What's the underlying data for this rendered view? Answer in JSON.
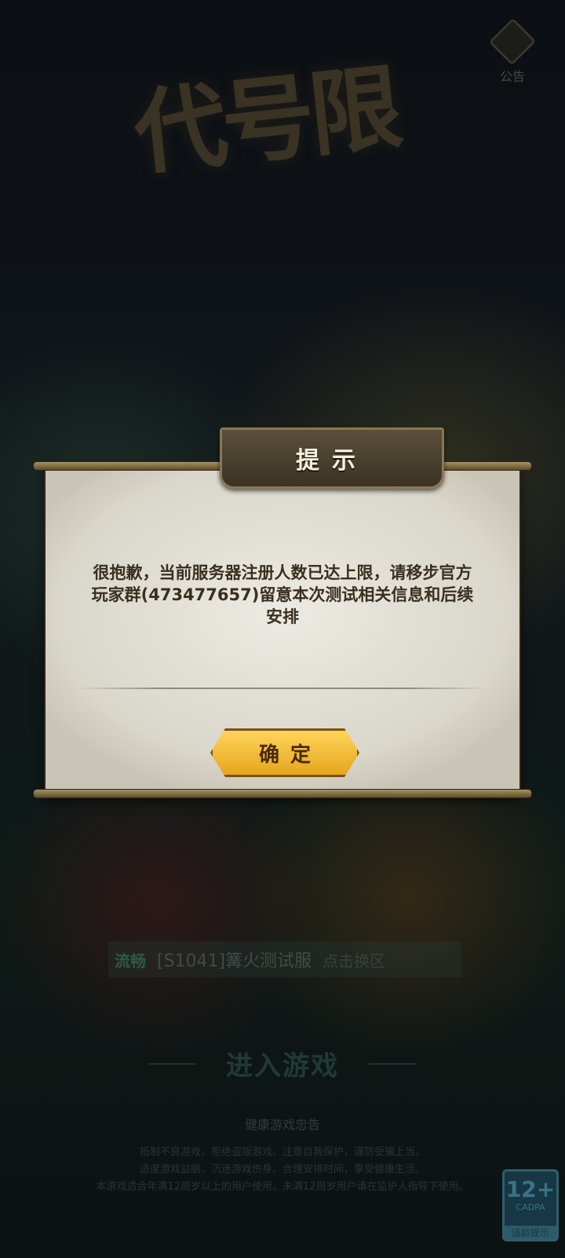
{
  "background": {
    "logo_text": "代号限",
    "notice_label": "公告",
    "server": {
      "badge": "流畅",
      "name": "[S1041]篝火测试服",
      "switch_label": "点击换区"
    },
    "enter_label": "进入游戏",
    "health": {
      "title": "健康游戏忠告",
      "lines": [
        "抵制不良游戏，拒绝盗版游戏。注意自我保护，谨防受骗上当。",
        "适度游戏益脑，沉迷游戏伤身。合理安排时间，享受健康生活。",
        "本游戏适合年满12周岁以上的用户使用。未满12周岁用户请在监护人指导下使用。"
      ]
    },
    "age_rating": {
      "number": "12+",
      "org": "CADPA",
      "tip": "适龄提示"
    }
  },
  "dialog": {
    "title": "提示",
    "message": "很抱歉，当前服务器注册人数已达上限，请移步官方玩家群(473477657)留意本次测试相关信息和后续安排",
    "confirm_label": "确定"
  },
  "colors": {
    "dialog_bg": "#e6e4db",
    "button_gold": "#f2bd37",
    "text_brown": "#3a2f1f"
  }
}
